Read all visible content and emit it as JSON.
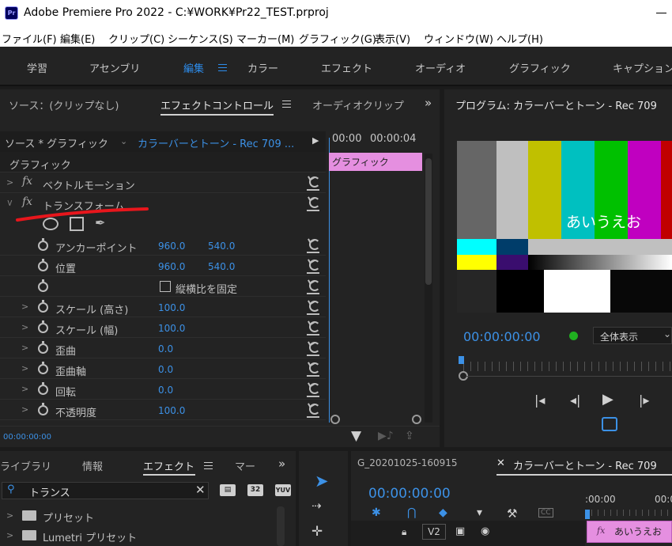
{
  "window": {
    "title": "Adobe Premiere Pro 2022 - C:¥WORK¥Pr22_TEST.prproj",
    "logo": "Pr"
  },
  "menu": [
    "ファイル(F)",
    "編集(E)",
    "クリップ(C)",
    "シーケンス(S)",
    "マーカー(M)",
    "グラフィック(G)",
    "表示(V)",
    "ウィンドウ(W)",
    "ヘルプ(H)"
  ],
  "workspaces": {
    "tabs": [
      "学習",
      "アセンブリ",
      "編集",
      "カラー",
      "エフェクト",
      "オーディオ",
      "グラフィック",
      "キャプション"
    ],
    "active": "編集"
  },
  "effect_controls": {
    "tabs": [
      "ソース：(クリップなし)",
      "エフェクトコントロール",
      "オーディオクリップ"
    ],
    "source_label": "ソース * グラフィック",
    "sequence_label": "カラーバーとトーン - Rec 709 ...",
    "timecode_start": "00:00",
    "timecode_end": "00:00:04",
    "clip_label": "グラフィック",
    "section": "グラフィック",
    "vector_motion": "ベクトルモーション",
    "transform": "トランスフォーム",
    "properties": [
      {
        "label": "アンカーポイント",
        "v1": "960.0",
        "v2": "540.0"
      },
      {
        "label": "位置",
        "v1": "960.0",
        "v2": "540.0"
      },
      {
        "label": "縦横比を固定",
        "checkbox": true
      },
      {
        "label": "スケール (高さ)",
        "v1": "100.0"
      },
      {
        "label": "スケール (幅)",
        "v1": "100.0"
      },
      {
        "label": "歪曲",
        "v1": "0.0"
      },
      {
        "label": "歪曲軸",
        "v1": "0.0"
      },
      {
        "label": "回転",
        "v1": "0.0"
      },
      {
        "label": "不透明度",
        "v1": "100.0"
      }
    ],
    "footer_timecode": "00:00:00:00"
  },
  "program_monitor": {
    "title": "プログラム: カラーバーとトーン - Rec 709",
    "overlay_text": "あいうえお",
    "timecode": "00:00:00:00",
    "zoom": "全体表示"
  },
  "library_panel": {
    "tabs": [
      "ライブラリ",
      "情報",
      "エフェクト",
      "マー"
    ],
    "search_value": "トランス",
    "badges": [
      "32",
      "YUV"
    ],
    "items": [
      "プリセット",
      "Lumetri プリセット"
    ]
  },
  "timeline_panel": {
    "tab_inactive": "G_20201025-160915",
    "tab_active": "カラーバーとトーン - Rec 709",
    "timecode": "00:00:00:00",
    "ruler_labels": [
      ":00:00",
      "00:0"
    ],
    "track": "V2",
    "clip_label": "あいうえお"
  },
  "colors": {
    "accent": "#2d8ceb",
    "annotation": "#e8161c",
    "clip_pink": "#e58fe0"
  }
}
